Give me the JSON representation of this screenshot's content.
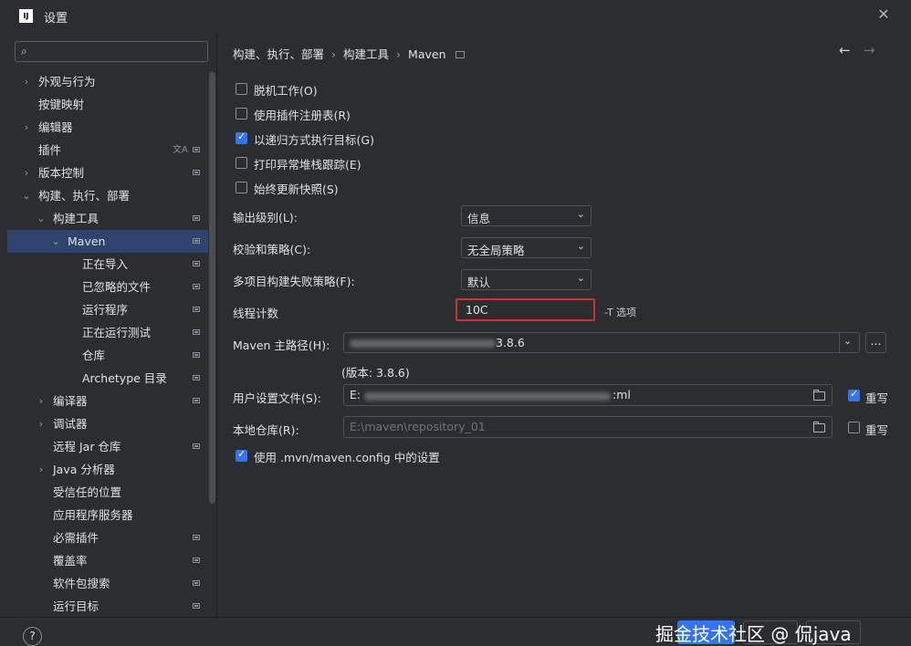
{
  "window": {
    "title": "设置",
    "app_icon_text": "IJ",
    "close_glyph": "✕"
  },
  "search": {
    "placeholder": "",
    "value": ""
  },
  "sidebar": {
    "items": [
      {
        "label": "外观与行为",
        "arrow": "›"
      },
      {
        "label": "按键映射"
      },
      {
        "label": "编辑器",
        "arrow": "›"
      },
      {
        "label": "插件"
      },
      {
        "label": "版本控制",
        "arrow": "›"
      },
      {
        "label": "构建、执行、部署",
        "arrow": "⌄"
      },
      {
        "label": "构建工具",
        "arrow": "⌄"
      },
      {
        "label": "Maven",
        "arrow": "⌄"
      },
      {
        "label": "正在导入"
      },
      {
        "label": "已忽略的文件"
      },
      {
        "label": "运行程序"
      },
      {
        "label": "正在运行测试"
      },
      {
        "label": "仓库"
      },
      {
        "label": "Archetype 目录"
      },
      {
        "label": "编译器",
        "arrow": "›"
      },
      {
        "label": "调试器",
        "arrow": "›"
      },
      {
        "label": "远程 Jar 仓库"
      },
      {
        "label": "Java 分析器",
        "arrow": "›"
      },
      {
        "label": "受信任的位置"
      },
      {
        "label": "应用程序服务器"
      },
      {
        "label": "必需插件"
      },
      {
        "label": "覆盖率"
      },
      {
        "label": "软件包搜索"
      },
      {
        "label": "运行目标"
      }
    ]
  },
  "breadcrumb": {
    "part1": "构建、执行、部署",
    "part2": "构建工具",
    "part3": "Maven",
    "sep": "›"
  },
  "nav": {
    "back": "←",
    "forward": "→"
  },
  "options": {
    "offline": {
      "label": "脱机工作(O)",
      "checked": false
    },
    "plugin_registry": {
      "label": "使用插件注册表(R)",
      "checked": false
    },
    "recursive": {
      "label": "以递归方式执行目标(G)",
      "checked": true
    },
    "print_stack": {
      "label": "打印异常堆栈跟踪(E)",
      "checked": false
    },
    "always_update": {
      "label": "始终更新快照(S)",
      "checked": false
    }
  },
  "output_level": {
    "label": "输出级别(L):",
    "value": "信息"
  },
  "checksum": {
    "label": "校验和策略(C):",
    "value": "无全局策略"
  },
  "multiproject": {
    "label": "多项目构建失败策略(F):",
    "value": "默认"
  },
  "threads": {
    "label": "线程计数",
    "value": "10C",
    "hint": "-T 选项"
  },
  "maven_home": {
    "label": "Maven 主路径(H):",
    "value_visible": "3.8.6",
    "version_text": "(版本: 3.8.6)",
    "browse": "..."
  },
  "user_settings": {
    "label": "用户设置文件(S):",
    "value_prefix": "E:",
    "value_suffix": ":ml",
    "override_label": "重写",
    "override_checked": true
  },
  "local_repo": {
    "label": "本地仓库(R):",
    "value": "E:\\maven\\repository_01",
    "override_label": "重写",
    "override_checked": false
  },
  "mvn_config": {
    "label": "使用 .mvn/maven.config 中的设置",
    "checked": true
  },
  "help": {
    "glyph": "?"
  },
  "watermark": "掘金技术社区 @ 侃java",
  "colors": {
    "accent": "#3574f0",
    "focus_border": "#d0332e",
    "selected_row": "#2e436e",
    "background": "#2b2d30"
  }
}
